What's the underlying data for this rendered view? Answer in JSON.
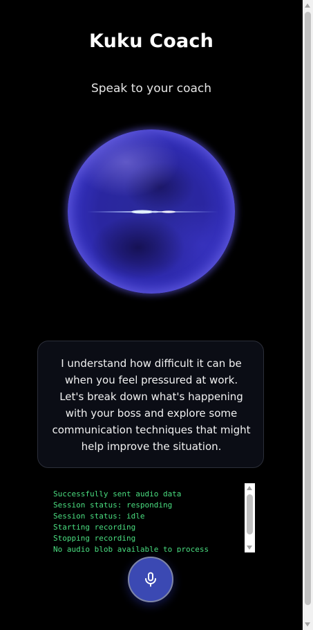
{
  "app": {
    "title": "Kuku Coach",
    "subtitle": "Speak to your coach"
  },
  "orb": {
    "icon": "voice-orb",
    "colors": {
      "core": "#2a26a0",
      "rim": "#5b57e8",
      "glow": "#6e64ff"
    }
  },
  "coach_message": {
    "text": "I understand how difficult it can be when you feel pressured at work. Let's break down what's happening with your boss and explore some communication techniques that might help improve the situation."
  },
  "log": {
    "lines": [
      "Successfully sent audio data",
      "Session status: responding",
      "Session status: idle",
      "Starting recording",
      "Stopping recording",
      "No audio blob available to process"
    ],
    "text_color": "#4ade80"
  },
  "mic_button": {
    "icon": "microphone-icon",
    "color": "#3b49b3"
  }
}
